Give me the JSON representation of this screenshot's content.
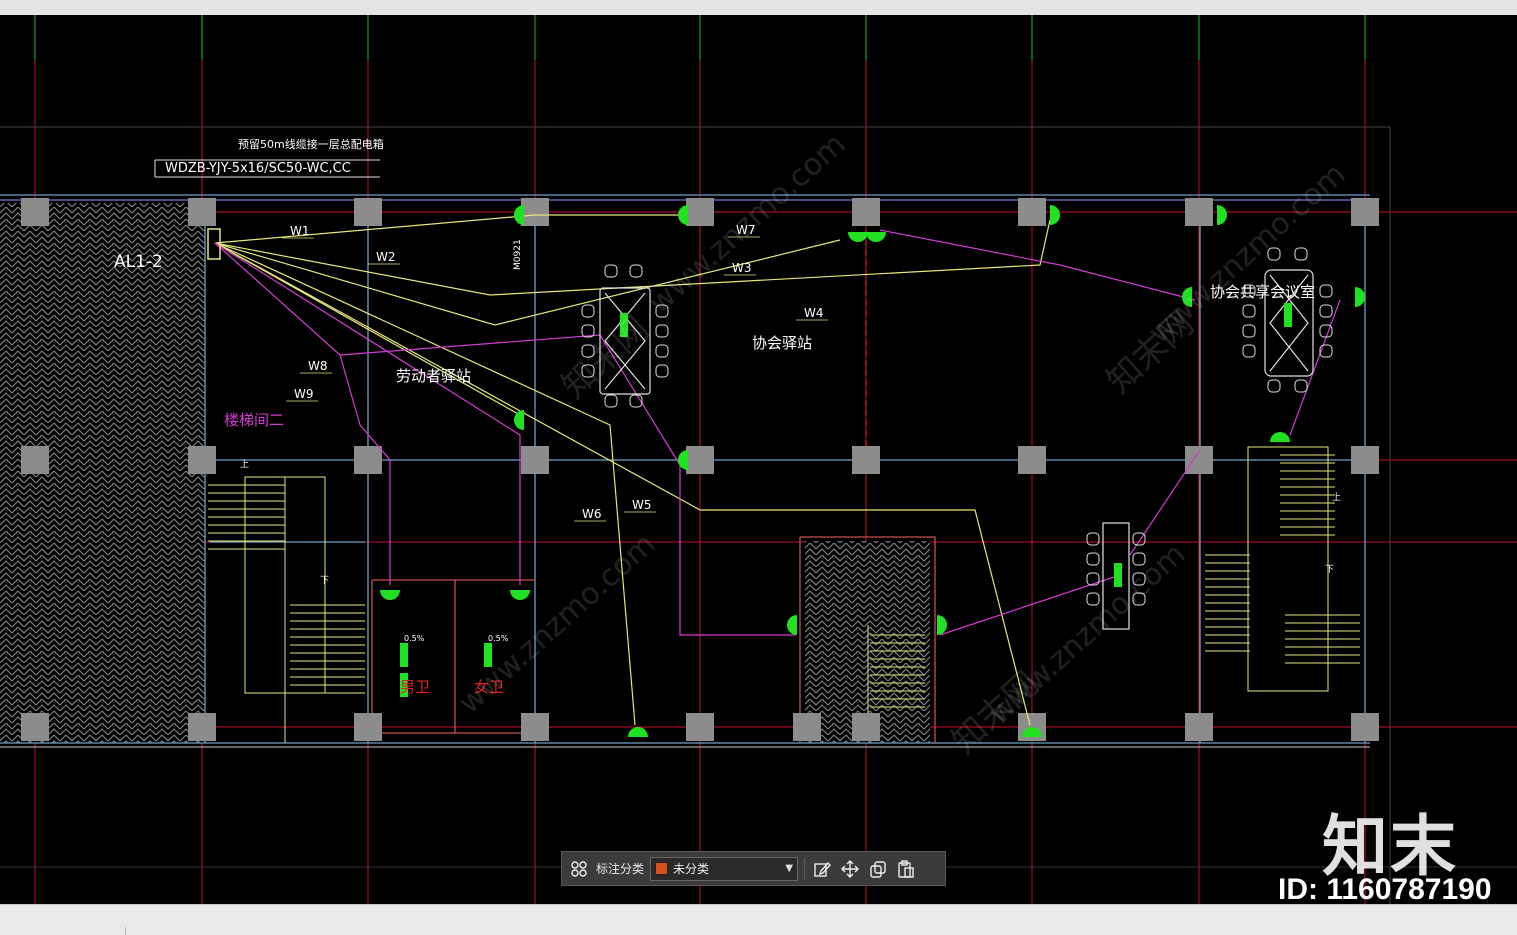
{
  "drawing": {
    "cable_note_line1": "预留50m线缆接一层总配电箱",
    "cable_note_line2": "WDZB-YJY-5x16/SC50-WC,CC",
    "panel_label": "AL1-2",
    "door_label": "M0921",
    "room_stair2": "楼梯间二",
    "room_worker_station": "劳动者驿站",
    "room_assoc_station": "协会驿站",
    "room_assoc_meeting": "协会共享会议室",
    "restroom_male": "男卫",
    "restroom_female": "女卫",
    "slope_1": "0.5%",
    "slope_2": "0.5%",
    "circuits": [
      "W1",
      "W2",
      "W3",
      "W4",
      "W5",
      "W6",
      "W7",
      "W8",
      "W9"
    ],
    "stair_up": "上",
    "stair_down": "下"
  },
  "watermark": {
    "text": "www.znzmo.com",
    "brand": "知末网"
  },
  "toolbar": {
    "annotation_label": "标注分类",
    "category_value": "未分类",
    "category_color": "#d94f1a"
  },
  "logo": {
    "brand": "知末",
    "id_text": "ID: 1160787190"
  },
  "colors": {
    "background": "#000000",
    "grid_red": "#c8102e",
    "grid_green": "#1fb81f",
    "wire_yellow": "#e6e67a",
    "wire_magenta": "#d43bd4",
    "column_gray": "#8c8c8c",
    "fixture_green": "#22e022"
  }
}
